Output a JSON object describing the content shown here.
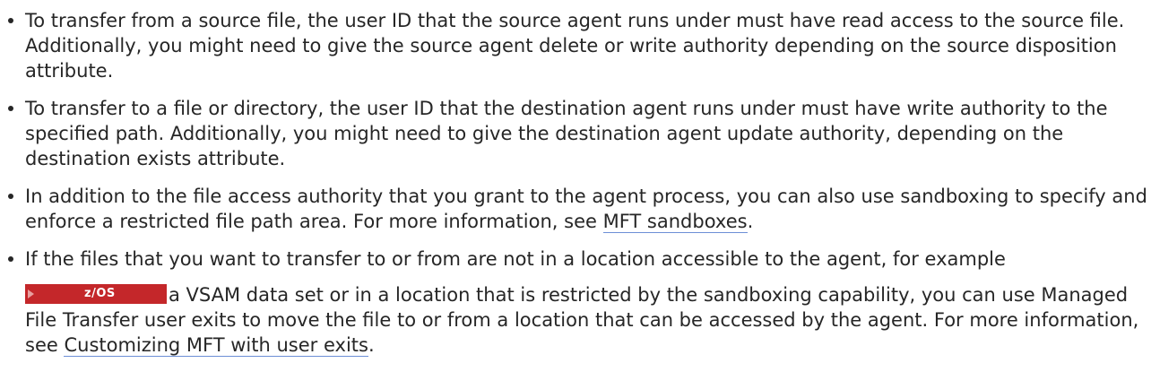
{
  "items": [
    {
      "text": "To transfer from a source file, the user ID that the source agent runs under must have read access to the source file. Additionally, you might need to give the source agent delete or write authority depending on the source disposition attribute."
    },
    {
      "text": "To transfer to a file or directory, the user ID that the destination agent runs under must have write authority to the specified path. Additionally, you might need to give the destination agent update authority, depending on the destination exists attribute."
    },
    {
      "text_before": "In addition to the file access authority that you grant to the agent process, you can also use sandboxing to specify and enforce a restricted file path area. For more information, see ",
      "link": "MFT sandboxes",
      "text_after": "."
    },
    {
      "line1": "If the files that you want to transfer to or from are not in a location accessible to the agent, for example",
      "badge": "z/OS",
      "text_before": "a VSAM data set or in a location that is restricted by the sandboxing capability, you can use Managed File Transfer user exits to move the file to or from a location that can be accessed by the agent. For more information, see ",
      "link": "Customizing MFT with user exits",
      "text_after": "."
    }
  ],
  "colors": {
    "text": "#262626",
    "badge": "#c4272a",
    "link_underline": "#6c8fd6"
  }
}
